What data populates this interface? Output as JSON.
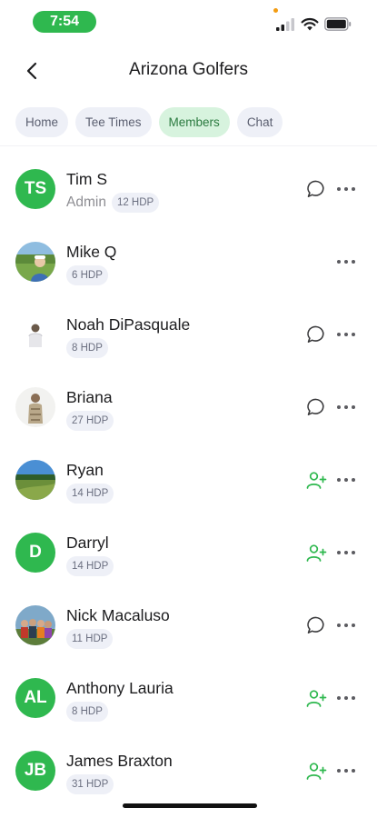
{
  "status_bar": {
    "time": "7:54"
  },
  "header": {
    "title": "Arizona Golfers"
  },
  "tabs": [
    {
      "label": "Home",
      "active": false
    },
    {
      "label": "Tee Times",
      "active": false
    },
    {
      "label": "Members",
      "active": true
    },
    {
      "label": "Chat",
      "active": false
    }
  ],
  "members": [
    {
      "name": "Tim S",
      "role": "Admin",
      "hdp": "12 HDP",
      "avatar": "initials",
      "initials": "TS",
      "action": "chat-icon"
    },
    {
      "name": "Mike Q",
      "role": "",
      "hdp": "6 HDP",
      "avatar": "photo-golf-course",
      "initials": "",
      "action": ""
    },
    {
      "name": "Noah DiPasquale",
      "role": "",
      "hdp": "8 HDP",
      "avatar": "photo-person-white",
      "initials": "",
      "action": "chat-icon"
    },
    {
      "name": "Briana",
      "role": "",
      "hdp": "27 HDP",
      "avatar": "photo-person-patterned",
      "initials": "",
      "action": "chat-icon"
    },
    {
      "name": "Ryan",
      "role": "",
      "hdp": "14 HDP",
      "avatar": "photo-fairway",
      "initials": "",
      "action": "add-friend-icon"
    },
    {
      "name": "Darryl",
      "role": "",
      "hdp": "14 HDP",
      "avatar": "initials",
      "initials": "D",
      "action": "add-friend-icon"
    },
    {
      "name": "Nick Macaluso",
      "role": "",
      "hdp": "11 HDP",
      "avatar": "photo-group",
      "initials": "",
      "action": "chat-icon"
    },
    {
      "name": "Anthony Lauria",
      "role": "",
      "hdp": "8 HDP",
      "avatar": "initials",
      "initials": "AL",
      "action": "add-friend-icon"
    },
    {
      "name": "James Braxton",
      "role": "",
      "hdp": "31 HDP",
      "avatar": "initials",
      "initials": "JB",
      "action": "add-friend-icon"
    }
  ],
  "colors": {
    "accent": "#2fb84f",
    "active_tab_bg": "#d7f3de",
    "tab_bg": "#eef0f7"
  }
}
